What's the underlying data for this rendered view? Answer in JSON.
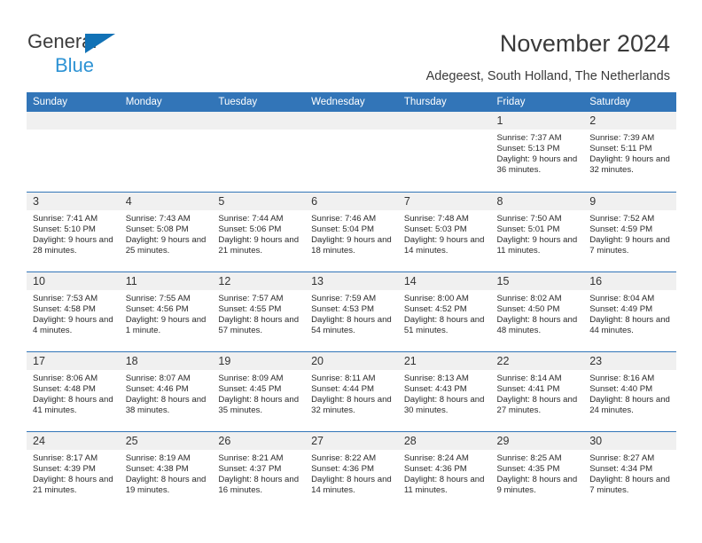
{
  "brand": {
    "name_part1": "General",
    "name_part2": "Blue",
    "triangle_color": "#1272b6",
    "blue_text_color": "#2e93d4"
  },
  "header": {
    "title": "November 2024",
    "subtitle": "Adegeest, South Holland, The Netherlands",
    "header_bg_color": "#3275b8",
    "daynum_bg_color": "#f0f0f0"
  },
  "weekday_headers": [
    "Sunday",
    "Monday",
    "Tuesday",
    "Wednesday",
    "Thursday",
    "Friday",
    "Saturday"
  ],
  "weeks": [
    [
      {
        "day": "",
        "empty": true
      },
      {
        "day": "",
        "empty": true
      },
      {
        "day": "",
        "empty": true
      },
      {
        "day": "",
        "empty": true
      },
      {
        "day": "",
        "empty": true
      },
      {
        "day": "1",
        "sunrise": "Sunrise: 7:37 AM",
        "sunset": "Sunset: 5:13 PM",
        "daylight": "Daylight: 9 hours and 36 minutes."
      },
      {
        "day": "2",
        "sunrise": "Sunrise: 7:39 AM",
        "sunset": "Sunset: 5:11 PM",
        "daylight": "Daylight: 9 hours and 32 minutes."
      }
    ],
    [
      {
        "day": "3",
        "sunrise": "Sunrise: 7:41 AM",
        "sunset": "Sunset: 5:10 PM",
        "daylight": "Daylight: 9 hours and 28 minutes."
      },
      {
        "day": "4",
        "sunrise": "Sunrise: 7:43 AM",
        "sunset": "Sunset: 5:08 PM",
        "daylight": "Daylight: 9 hours and 25 minutes."
      },
      {
        "day": "5",
        "sunrise": "Sunrise: 7:44 AM",
        "sunset": "Sunset: 5:06 PM",
        "daylight": "Daylight: 9 hours and 21 minutes."
      },
      {
        "day": "6",
        "sunrise": "Sunrise: 7:46 AM",
        "sunset": "Sunset: 5:04 PM",
        "daylight": "Daylight: 9 hours and 18 minutes."
      },
      {
        "day": "7",
        "sunrise": "Sunrise: 7:48 AM",
        "sunset": "Sunset: 5:03 PM",
        "daylight": "Daylight: 9 hours and 14 minutes."
      },
      {
        "day": "8",
        "sunrise": "Sunrise: 7:50 AM",
        "sunset": "Sunset: 5:01 PM",
        "daylight": "Daylight: 9 hours and 11 minutes."
      },
      {
        "day": "9",
        "sunrise": "Sunrise: 7:52 AM",
        "sunset": "Sunset: 4:59 PM",
        "daylight": "Daylight: 9 hours and 7 minutes."
      }
    ],
    [
      {
        "day": "10",
        "sunrise": "Sunrise: 7:53 AM",
        "sunset": "Sunset: 4:58 PM",
        "daylight": "Daylight: 9 hours and 4 minutes."
      },
      {
        "day": "11",
        "sunrise": "Sunrise: 7:55 AM",
        "sunset": "Sunset: 4:56 PM",
        "daylight": "Daylight: 9 hours and 1 minute."
      },
      {
        "day": "12",
        "sunrise": "Sunrise: 7:57 AM",
        "sunset": "Sunset: 4:55 PM",
        "daylight": "Daylight: 8 hours and 57 minutes."
      },
      {
        "day": "13",
        "sunrise": "Sunrise: 7:59 AM",
        "sunset": "Sunset: 4:53 PM",
        "daylight": "Daylight: 8 hours and 54 minutes."
      },
      {
        "day": "14",
        "sunrise": "Sunrise: 8:00 AM",
        "sunset": "Sunset: 4:52 PM",
        "daylight": "Daylight: 8 hours and 51 minutes."
      },
      {
        "day": "15",
        "sunrise": "Sunrise: 8:02 AM",
        "sunset": "Sunset: 4:50 PM",
        "daylight": "Daylight: 8 hours and 48 minutes."
      },
      {
        "day": "16",
        "sunrise": "Sunrise: 8:04 AM",
        "sunset": "Sunset: 4:49 PM",
        "daylight": "Daylight: 8 hours and 44 minutes."
      }
    ],
    [
      {
        "day": "17",
        "sunrise": "Sunrise: 8:06 AM",
        "sunset": "Sunset: 4:48 PM",
        "daylight": "Daylight: 8 hours and 41 minutes."
      },
      {
        "day": "18",
        "sunrise": "Sunrise: 8:07 AM",
        "sunset": "Sunset: 4:46 PM",
        "daylight": "Daylight: 8 hours and 38 minutes."
      },
      {
        "day": "19",
        "sunrise": "Sunrise: 8:09 AM",
        "sunset": "Sunset: 4:45 PM",
        "daylight": "Daylight: 8 hours and 35 minutes."
      },
      {
        "day": "20",
        "sunrise": "Sunrise: 8:11 AM",
        "sunset": "Sunset: 4:44 PM",
        "daylight": "Daylight: 8 hours and 32 minutes."
      },
      {
        "day": "21",
        "sunrise": "Sunrise: 8:13 AM",
        "sunset": "Sunset: 4:43 PM",
        "daylight": "Daylight: 8 hours and 30 minutes."
      },
      {
        "day": "22",
        "sunrise": "Sunrise: 8:14 AM",
        "sunset": "Sunset: 4:41 PM",
        "daylight": "Daylight: 8 hours and 27 minutes."
      },
      {
        "day": "23",
        "sunrise": "Sunrise: 8:16 AM",
        "sunset": "Sunset: 4:40 PM",
        "daylight": "Daylight: 8 hours and 24 minutes."
      }
    ],
    [
      {
        "day": "24",
        "sunrise": "Sunrise: 8:17 AM",
        "sunset": "Sunset: 4:39 PM",
        "daylight": "Daylight: 8 hours and 21 minutes."
      },
      {
        "day": "25",
        "sunrise": "Sunrise: 8:19 AM",
        "sunset": "Sunset: 4:38 PM",
        "daylight": "Daylight: 8 hours and 19 minutes."
      },
      {
        "day": "26",
        "sunrise": "Sunrise: 8:21 AM",
        "sunset": "Sunset: 4:37 PM",
        "daylight": "Daylight: 8 hours and 16 minutes."
      },
      {
        "day": "27",
        "sunrise": "Sunrise: 8:22 AM",
        "sunset": "Sunset: 4:36 PM",
        "daylight": "Daylight: 8 hours and 14 minutes."
      },
      {
        "day": "28",
        "sunrise": "Sunrise: 8:24 AM",
        "sunset": "Sunset: 4:36 PM",
        "daylight": "Daylight: 8 hours and 11 minutes."
      },
      {
        "day": "29",
        "sunrise": "Sunrise: 8:25 AM",
        "sunset": "Sunset: 4:35 PM",
        "daylight": "Daylight: 8 hours and 9 minutes."
      },
      {
        "day": "30",
        "sunrise": "Sunrise: 8:27 AM",
        "sunset": "Sunset: 4:34 PM",
        "daylight": "Daylight: 8 hours and 7 minutes."
      }
    ]
  ]
}
